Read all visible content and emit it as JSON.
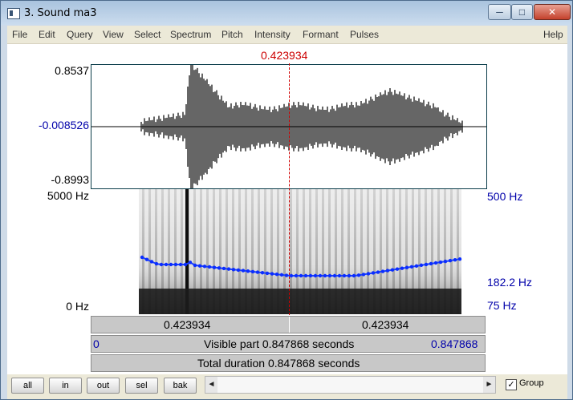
{
  "window": {
    "title": "3. Sound ma3",
    "buttons": [
      "─",
      "□",
      "✕"
    ]
  },
  "menu": [
    "File",
    "Edit",
    "Query",
    "View",
    "Select",
    "Spectrum",
    "Pitch",
    "Intensity",
    "Formant",
    "Pulses",
    "Help"
  ],
  "cursor": {
    "time_label": "0.423934"
  },
  "waveform": {
    "ymax": "0.8537",
    "ymid": "-0.008526",
    "ymin": "-0.8993"
  },
  "spectrogram": {
    "freq_top": "5000 Hz",
    "freq_bottom": "0 Hz",
    "pitch_top": "500 Hz",
    "pitch_mid": "182.2 Hz",
    "pitch_bottom": "75 Hz"
  },
  "time_bars": {
    "left_segment": "0.423934",
    "right_segment": "0.423934",
    "visible_start": "0",
    "visible_part": "Visible part 0.847868 seconds",
    "visible_end": "0.847868",
    "total_duration": "Total duration 0.847868 seconds"
  },
  "controls": {
    "buttons": [
      "all",
      "in",
      "out",
      "sel",
      "bak"
    ],
    "group_label": "Group",
    "group_checked": true,
    "scroll_left": "◄",
    "scroll_right": "►"
  }
}
